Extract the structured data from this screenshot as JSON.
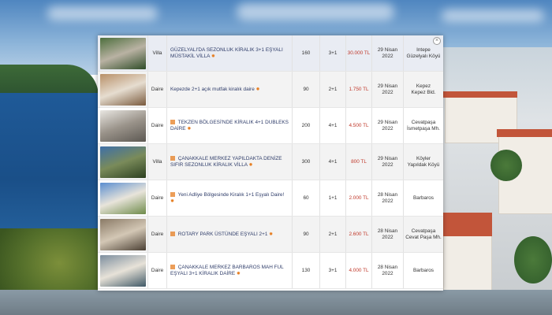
{
  "listings": [
    {
      "type": "Villa",
      "title": "GÜZELYALI'DA SEZONLUK KİRALIK 3+1 EŞYALI MÜSTAKİL VİLLA",
      "has_tag": false,
      "area": "160",
      "rooms": "3+1",
      "price": "30.000 TL",
      "date_line1": "29 Nisan",
      "date_line2": "2022",
      "loc_line1": "Intepe",
      "loc_line2": "Güzelyalı Köyü",
      "thumb_colors": [
        "#4d6f3d",
        "#b9b2a3",
        "#2f4d28"
      ]
    },
    {
      "type": "Daire",
      "title": "Kepezde 2+1 açık mutfak kiralık daire",
      "has_tag": false,
      "area": "90",
      "rooms": "2+1",
      "price": "1.750 TL",
      "date_line1": "29 Nisan",
      "date_line2": "2022",
      "loc_line1": "Kepez",
      "loc_line2": "Kepez Bld.",
      "thumb_colors": [
        "#b89068",
        "#e6ddd0",
        "#7a5a3d"
      ]
    },
    {
      "type": "Daire",
      "title": "TEKZEN BÖLGESİ'NDE KİRALIK 4+1 DUBLEKS DAİRE",
      "has_tag": true,
      "area": "200",
      "rooms": "4+1",
      "price": "4.500 TL",
      "date_line1": "29 Nisan",
      "date_line2": "2022",
      "loc_line1": "Cevatpaşa",
      "loc_line2": "İsmetpaşa Mh.",
      "thumb_colors": [
        "#e9e7e2",
        "#9a938a",
        "#5c5852"
      ]
    },
    {
      "type": "Villa",
      "title": "ÇANAKKALE MERKEZ YAPILDAKTA DENİZE SIFIR SEZONLUK KİRALIK VİLLA",
      "has_tag": true,
      "area": "300",
      "rooms": "4+1",
      "price": "800 TL",
      "date_line1": "29 Nisan",
      "date_line2": "2022",
      "loc_line1": "Köyler",
      "loc_line2": "Yapıldak Köyü",
      "thumb_colors": [
        "#3e6fa8",
        "#7a8b5a",
        "#2c4020"
      ]
    },
    {
      "type": "Daire",
      "title": "Yeni Adliye Bölgesinde Kiralık 1+1 Eşyalı Daire!",
      "has_tag": true,
      "area": "60",
      "rooms": "1+1",
      "price": "2.000 TL",
      "date_line1": "28 Nisan",
      "date_line2": "2022",
      "loc_line1": "Barbaros",
      "loc_line2": "",
      "thumb_colors": [
        "#5a8ed0",
        "#e8e4da",
        "#6e8b4a"
      ]
    },
    {
      "type": "Daire",
      "title": "ROTARY PARK ÜSTÜNDE EŞYALI 2+1",
      "has_tag": true,
      "area": "90",
      "rooms": "2+1",
      "price": "2.600 TL",
      "date_line1": "28 Nisan",
      "date_line2": "2022",
      "loc_line1": "Cevatpaşa",
      "loc_line2": "Cevat Paşa Mh.",
      "thumb_colors": [
        "#8a7a66",
        "#d3c7b5",
        "#4a3f33"
      ]
    },
    {
      "type": "Daire",
      "title": "ÇANAKKALE MERKEZ BARBAROS MAH FUL EŞYALI 3+1 KİRALIK DAİRE",
      "has_tag": true,
      "area": "130",
      "rooms": "3+1",
      "price": "4.000 TL",
      "date_line1": "28 Nisan",
      "date_line2": "2022",
      "loc_line1": "Barbaros",
      "loc_line2": "",
      "thumb_colors": [
        "#7c8e9e",
        "#e7e2d8",
        "#3f5866"
      ]
    }
  ],
  "close_icon": "close-icon",
  "star_icon": "star-icon",
  "tag_icon": "tag-icon"
}
